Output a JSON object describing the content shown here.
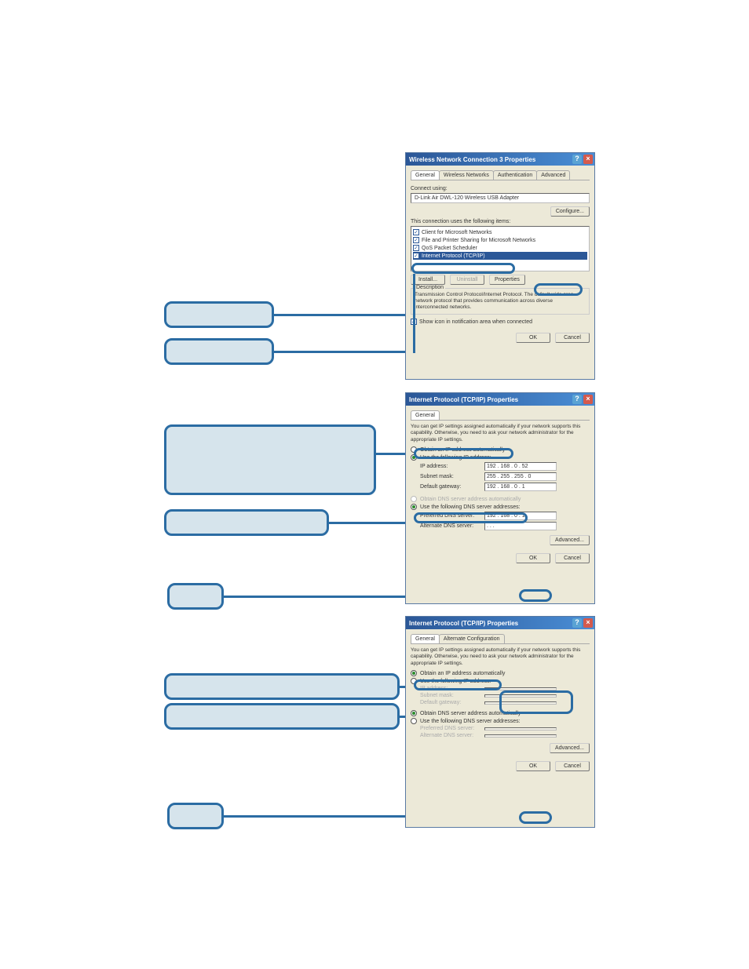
{
  "callouts": {
    "c1": "",
    "c2": "",
    "c3": "",
    "c4": "",
    "c5": "",
    "c6": "",
    "c7": "",
    "c8": ""
  },
  "dlg1": {
    "title": "Wireless Network Connection 3 Properties",
    "tabs": [
      "General",
      "Wireless Networks",
      "Authentication",
      "Advanced"
    ],
    "connect_using_label": "Connect using:",
    "adapter": "D-Link Air DWL-120 Wireless USB Adapter",
    "configure_btn": "Configure...",
    "items_label": "This connection uses the following items:",
    "item1": "Client for Microsoft Networks",
    "item2": "File and Printer Sharing for Microsoft Networks",
    "item3": "QoS Packet Scheduler",
    "item4": "Internet Protocol (TCP/IP)",
    "install_btn": "Install...",
    "uninstall_btn": "Uninstall",
    "properties_btn": "Properties",
    "desc_legend": "Description",
    "desc_text": "Transmission Control Protocol/Internet Protocol. The default wide area network protocol that provides communication across diverse interconnected networks.",
    "show_icon": "Show icon in notification area when connected",
    "ok_btn": "OK",
    "cancel_btn": "Cancel"
  },
  "dlg2": {
    "title": "Internet Protocol (TCP/IP) Properties",
    "tab_general": "General",
    "note": "You can get IP settings assigned automatically if your network supports this capability. Otherwise, you need to ask your network administrator for the appropriate IP settings.",
    "obtain_ip": "Obtain an IP address automatically",
    "use_ip": "Use the following IP address:",
    "ip_addr_lbl": "IP address:",
    "ip_addr": "192 . 168 .  0  .  52",
    "subnet_lbl": "Subnet mask:",
    "subnet": "255 . 255 . 255 .  0",
    "gateway_lbl": "Default gateway:",
    "gateway": "192 . 168 .  0  .  1",
    "obtain_dns": "Obtain DNS server address automatically",
    "use_dns": "Use the following DNS server addresses:",
    "pref_dns_lbl": "Preferred DNS server:",
    "pref_dns": "192 . 168 .  0  .  1",
    "alt_dns_lbl": "Alternate DNS server:",
    "alt_dns": " .       .       . ",
    "advanced_btn": "Advanced...",
    "ok_btn": "OK",
    "cancel_btn": "Cancel"
  },
  "dlg3": {
    "title": "Internet Protocol (TCP/IP) Properties",
    "tab_general": "General",
    "tab_alt": "Alternate Configuration",
    "note": "You can get IP settings assigned automatically if your network supports this capability. Otherwise, you need to ask your network administrator for the appropriate IP settings.",
    "obtain_ip": "Obtain an IP address automatically",
    "use_ip": "Use the following IP address:",
    "ip_addr_lbl": "IP address:",
    "subnet_lbl": "Subnet mask:",
    "gateway_lbl": "Default gateway:",
    "obtain_dns": "Obtain DNS server address automatically",
    "use_dns": "Use the following DNS server addresses:",
    "pref_dns_lbl": "Preferred DNS server:",
    "alt_dns_lbl": "Alternate DNS server:",
    "advanced_btn": "Advanced...",
    "ok_btn": "OK",
    "cancel_btn": "Cancel"
  }
}
